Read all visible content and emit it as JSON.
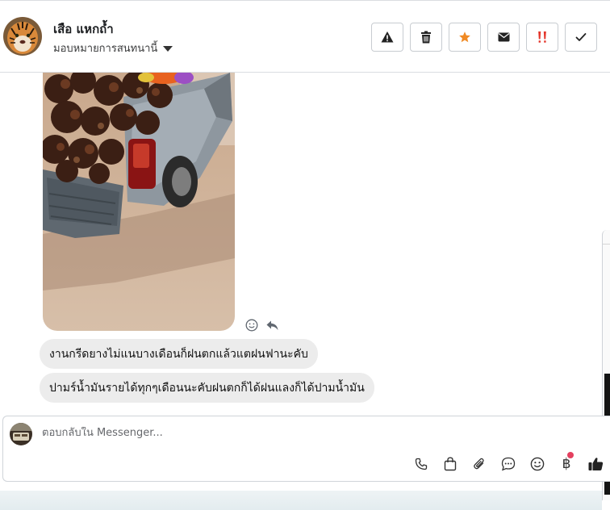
{
  "header": {
    "contact_name": "เสือ แหกถ้ำ",
    "assign_label": "มอบหมายการสนทนานี้",
    "actions": [
      {
        "name": "report-spam-button",
        "icon": "warning-icon"
      },
      {
        "name": "delete-button",
        "icon": "trash-icon"
      },
      {
        "name": "star-button",
        "icon": "star-icon",
        "color": "#f08a24"
      },
      {
        "name": "mark-unread-button",
        "icon": "envelope-icon"
      },
      {
        "name": "follow-up-button",
        "icon": "exclamation-icon",
        "color": "#e4362b"
      },
      {
        "name": "mark-done-button",
        "icon": "check-icon"
      }
    ]
  },
  "messages": [
    {
      "type": "image",
      "description_icon": "truck-photo"
    },
    {
      "type": "text",
      "text": "งานกรีดยางไม่แนบางเดือนก็ฝนตกแล้วแตฝนฟานะคับ"
    },
    {
      "type": "text",
      "text": "ปามร์น้ำมันรายได้ทุกๆเดือนนะคับฝนตกก็ได้ฝนแลงก็ได้ปามน้ำมัน"
    }
  ],
  "composer": {
    "placeholder": "ตอบกลับใน Messenger...",
    "tools": [
      "phone-icon",
      "shopping-bag-icon",
      "paperclip-icon",
      "saved-reply-icon",
      "emoji-icon",
      "baht-icon",
      "thumbs-up-icon"
    ],
    "baht_symbol": "฿"
  },
  "colors": {
    "bubble": "#ececec",
    "accent_star": "#f08a24",
    "accent_alert": "#e4362b",
    "notification_dot": "#e4405f"
  }
}
